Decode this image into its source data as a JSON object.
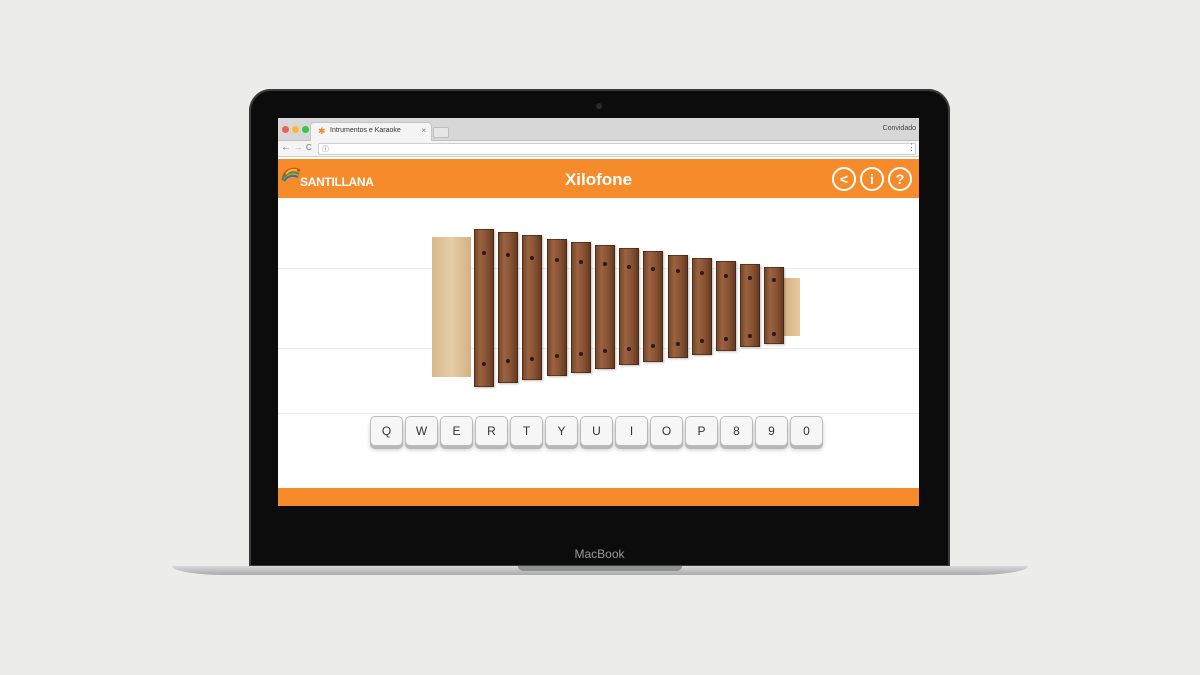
{
  "device": {
    "brand_label": "MacBook"
  },
  "browser": {
    "tab_title": "Intrumentos e Karaoke",
    "tab_close": "×",
    "profile_label": "Convidado",
    "nav_back": "←",
    "nav_forward": "→",
    "nav_reload": "C",
    "info_icon": "ⓘ",
    "menu_icon": "⋮",
    "window_dots": [
      "#ee5e56",
      "#f7bc2f",
      "#33c748"
    ]
  },
  "app": {
    "logo_text": "SANTILLANA",
    "title": "Xilofone",
    "header_buttons": [
      {
        "name": "back-circle-button",
        "glyph": "<"
      },
      {
        "name": "info-button",
        "glyph": "i"
      },
      {
        "name": "help-button",
        "glyph": "?"
      }
    ],
    "accent_color": "#f68b2c"
  },
  "xylophone": {
    "bar_count": 13,
    "keys": [
      "Q",
      "W",
      "E",
      "R",
      "T",
      "Y",
      "U",
      "I",
      "O",
      "P",
      "8",
      "9",
      "0"
    ]
  }
}
